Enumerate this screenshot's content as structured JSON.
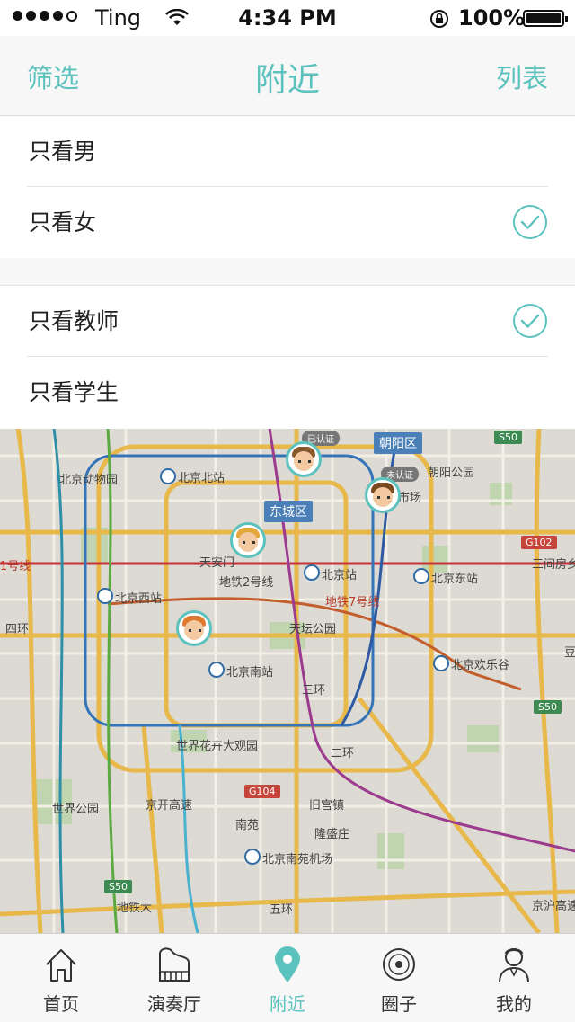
{
  "status_bar": {
    "carrier": "Ting",
    "time": "4:34 PM",
    "battery": "100%"
  },
  "navbar": {
    "left": "筛选",
    "title": "附近",
    "right": "列表"
  },
  "filters": {
    "group1": [
      {
        "label": "只看男",
        "checked": false
      },
      {
        "label": "只看女",
        "checked": true
      }
    ],
    "group2": [
      {
        "label": "只看教师",
        "checked": true
      },
      {
        "label": "只看学生",
        "checked": false
      }
    ]
  },
  "map": {
    "labels": {
      "beijing_zoo": "北京动物园",
      "beijing_north": "北京北站",
      "chaoyang_district": "朝阳区",
      "chaoyang_park": "朝阳公园",
      "dongcheng": "东城区",
      "tiananmen": "天安门",
      "line2": "地铁2号线",
      "beijing_station": "北京站",
      "beijing_east": "北京东站",
      "line7": "地铁7号线",
      "beijing_west": "北京西站",
      "temple_heaven": "天坛公园",
      "happy_valley": "北京欢乐谷",
      "beijing_south": "北京南站",
      "san_huan": "三环",
      "world_flower": "世界花卉大观园",
      "world_park": "世界公园",
      "jingkai": "京开高速",
      "jiugongzhen": "旧宫镇",
      "nanyuan": "南苑",
      "longshengzhuang": "隆盛庄",
      "nanyuan_airport": "北京南苑机场",
      "line1": "1号线",
      "san_jianfang": "三间房乡",
      "wu_huan": "五环",
      "si_huan": "四环",
      "er_huan": "二环",
      "jinhai": "京沪高速",
      "metro_da": "地铁大",
      "market": "门市场",
      "dou": "豆"
    },
    "shields": {
      "s50_top": "S50",
      "g102": "G102",
      "s50_right": "S50",
      "g104": "G104",
      "s50_bottom": "S50"
    },
    "badges": {
      "verified": "已认证",
      "unverified": "未认证"
    }
  },
  "tabs": [
    {
      "label": "首页",
      "icon": "home-icon"
    },
    {
      "label": "演奏厅",
      "icon": "piano-icon"
    },
    {
      "label": "附近",
      "icon": "location-pin-icon",
      "active": true
    },
    {
      "label": "圈子",
      "icon": "disc-icon"
    },
    {
      "label": "我的",
      "icon": "profile-icon"
    }
  ],
  "colors": {
    "accent": "#5cc2be",
    "map_background": "#dcdad2"
  }
}
